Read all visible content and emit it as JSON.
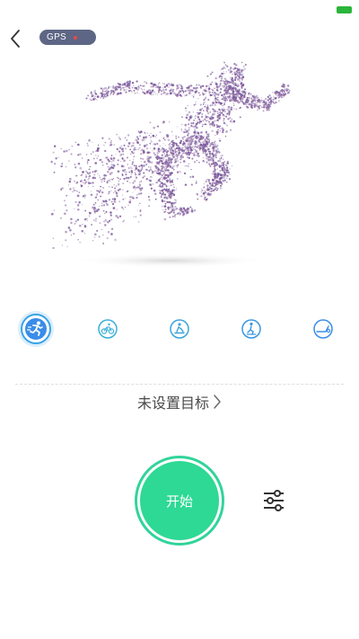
{
  "status_bar": {
    "battery_color": "#2bb53a"
  },
  "header": {
    "back_icon": "chevron-left-icon",
    "gps_label": "GPS",
    "gps_signal_color": "#e8494a"
  },
  "hero": {
    "image": "particle-runner-illustration"
  },
  "modes": {
    "selected_index": 0,
    "track_colors": [
      "#3ee0c6",
      "#3a8de8"
    ],
    "items": [
      {
        "icon": "running-icon"
      },
      {
        "icon": "cycling-icon"
      },
      {
        "icon": "rowing-icon"
      },
      {
        "icon": "elliptical-icon"
      },
      {
        "icon": "treadmill-icon"
      }
    ]
  },
  "goal": {
    "label": "未设置目标"
  },
  "start": {
    "label": "开始",
    "color": "#2dd994"
  },
  "settings": {
    "icon": "sliders-icon"
  }
}
